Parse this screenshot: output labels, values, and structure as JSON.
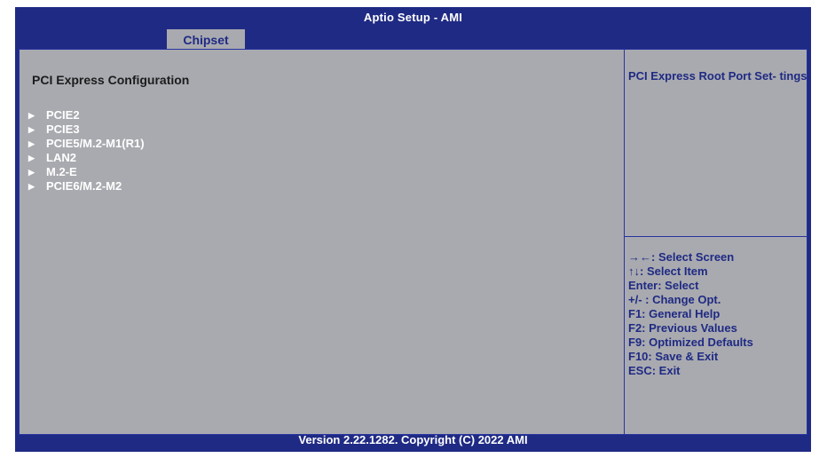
{
  "header": {
    "title": "Aptio Setup - AMI"
  },
  "tabs": [
    {
      "label": "Chipset"
    }
  ],
  "main": {
    "section_title": "PCI Express Configuration",
    "items": [
      {
        "label": "PCIE2"
      },
      {
        "label": "PCIE3"
      },
      {
        "label": "PCIE5/M.2-M1(R1)"
      },
      {
        "label": "LAN2"
      },
      {
        "label": "M.2-E"
      },
      {
        "label": "PCIE6/M.2-M2"
      }
    ],
    "selected_index": 0
  },
  "help": {
    "text": "PCI Express Root Port Set- tings."
  },
  "keys": [
    "→←: Select Screen",
    "↑↓: Select Item",
    "Enter: Select",
    "+/- : Change Opt.",
    "F1: General Help",
    "F2: Previous Values",
    "F9: Optimized Defaults",
    "F10: Save & Exit",
    "ESC: Exit"
  ],
  "footer": {
    "text": "Version 2.22.1282. Copyright (C) 2022 AMI"
  },
  "colors": {
    "frame": "#1f2a84",
    "panel": "#a9aaaf",
    "menu_text": "#ffffff",
    "help_text": "#1f2a84"
  }
}
